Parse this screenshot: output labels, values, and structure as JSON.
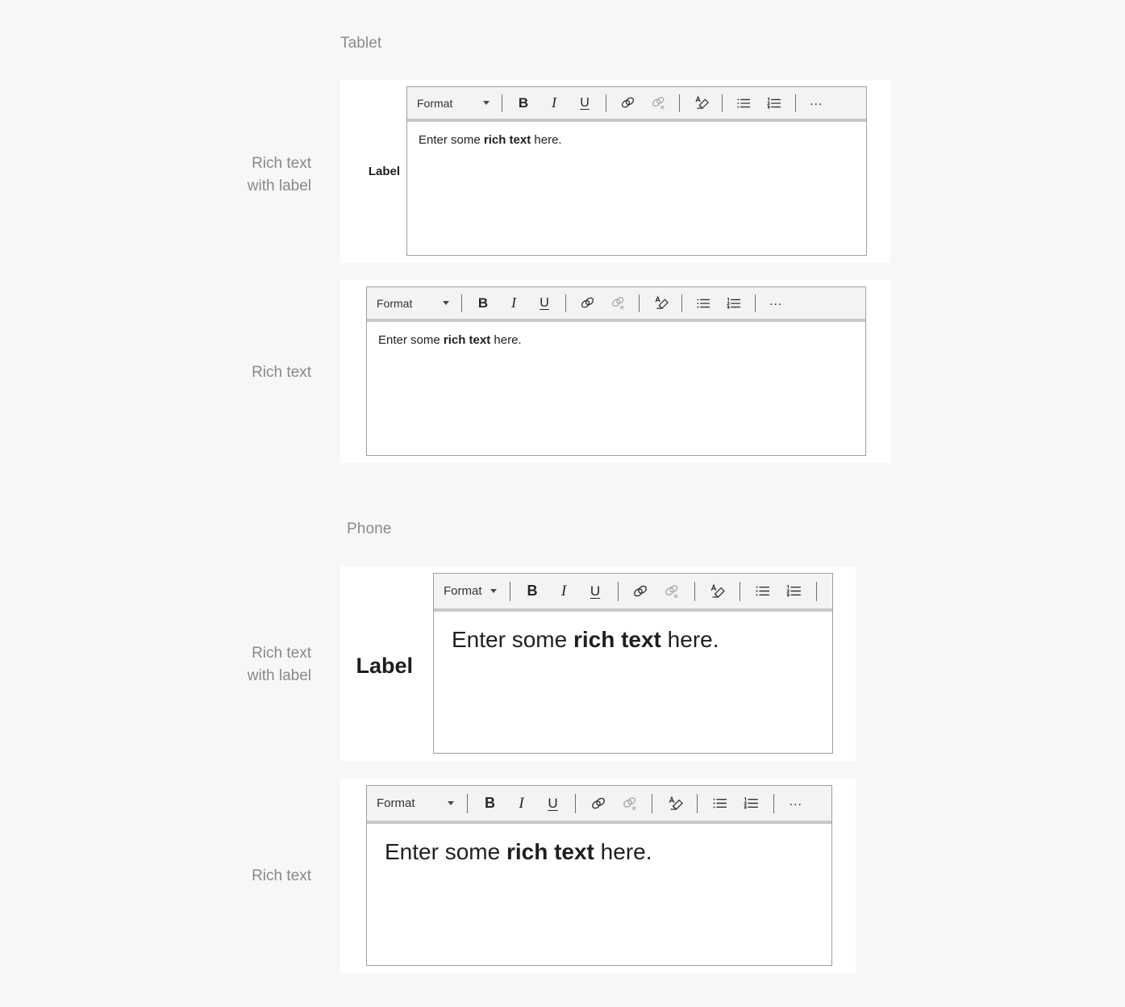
{
  "page": {
    "background": "#f7f7f7",
    "sections": [
      {
        "id": "tablet",
        "title": "Tablet"
      },
      {
        "id": "phone",
        "title": "Phone"
      }
    ]
  },
  "row_labels": {
    "rich_text_with_label_line1": "Rich text",
    "rich_text_with_label_line2": "with label",
    "rich_text": "Rich text"
  },
  "toolbar": {
    "format_label": "Format",
    "caret_icon": "chevron-down-icon",
    "buttons": [
      {
        "name": "bold-button",
        "glyph": "B",
        "icon": "bold-icon",
        "disabled": false
      },
      {
        "name": "italic-button",
        "glyph": "I",
        "icon": "italic-icon",
        "disabled": false
      },
      {
        "name": "underline-button",
        "glyph": "U",
        "icon": "underline-icon",
        "disabled": false
      },
      {
        "name": "insert-link-button",
        "glyph": "",
        "icon": "link-icon",
        "disabled": false
      },
      {
        "name": "remove-link-button",
        "glyph": "",
        "icon": "unlink-icon",
        "disabled": true
      },
      {
        "name": "clear-formatting-button",
        "glyph": "",
        "icon": "clear-formatting-icon",
        "disabled": false
      },
      {
        "name": "bulleted-list-button",
        "glyph": "",
        "icon": "bulleted-list-icon",
        "disabled": false
      },
      {
        "name": "numbered-list-button",
        "glyph": "",
        "icon": "numbered-list-icon",
        "disabled": false
      },
      {
        "name": "more-options-button",
        "glyph": "…",
        "icon": "ellipsis-icon",
        "disabled": false
      }
    ]
  },
  "editor_content": {
    "before": "Enter some ",
    "bold": "rich text",
    "after": " here."
  },
  "cards": [
    {
      "id": "card-1",
      "section": "tablet",
      "variant": "tablet",
      "has_label": true,
      "label": "Label"
    },
    {
      "id": "card-2",
      "section": "tablet",
      "variant": "tablet",
      "has_label": false,
      "label": ""
    },
    {
      "id": "card-3",
      "section": "phone",
      "variant": "phone",
      "has_label": true,
      "label": "Label"
    },
    {
      "id": "card-4",
      "section": "phone",
      "variant": "phone",
      "has_label": false,
      "label": ""
    }
  ],
  "colors": {
    "page_background": "#f7f7f7",
    "card_background": "#ffffff",
    "toolbar_background": "#f3f3f3",
    "toolbar_underline": "#c8c8c8",
    "editor_border": "#9e9e9e",
    "label_gray": "#888888",
    "text": "#1f1f1f"
  }
}
